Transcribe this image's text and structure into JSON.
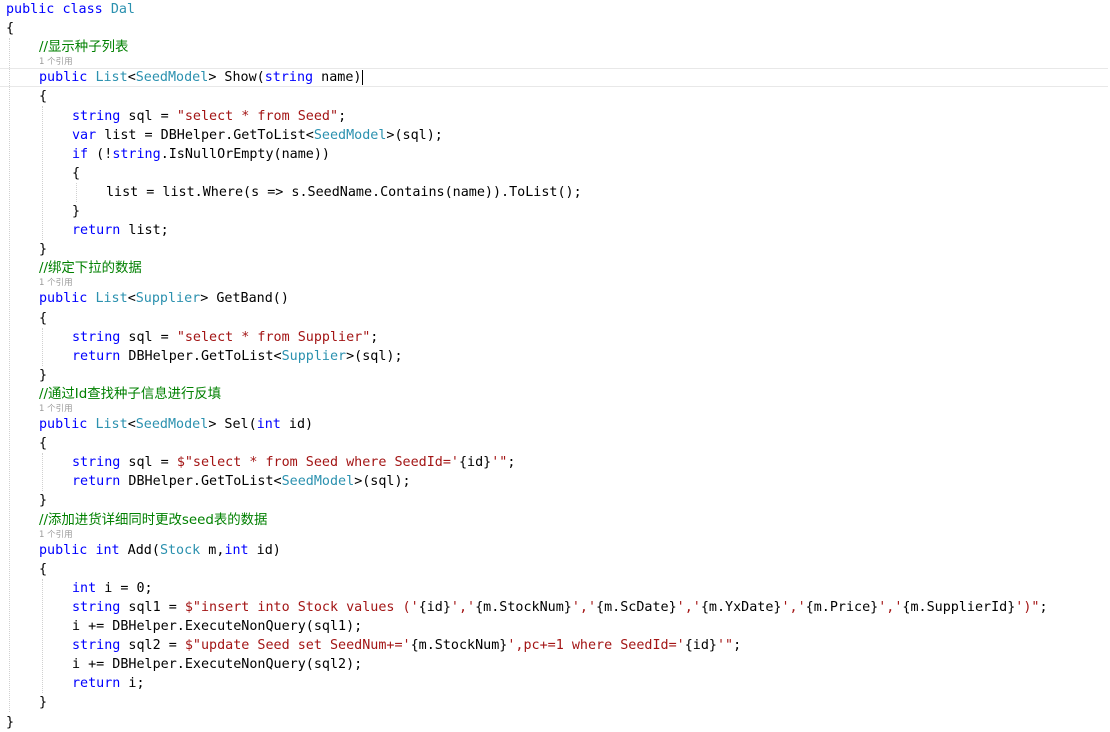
{
  "colors": {
    "keyword": "#0000ff",
    "type": "#2b91af",
    "string": "#a31515",
    "comment": "#008000",
    "plain": "#000000",
    "codelens": "#9a9a9a"
  },
  "lines": [
    {
      "indent": 0,
      "tokens": [
        {
          "t": "public",
          "c": "kw"
        },
        {
          "t": " "
        },
        {
          "t": "class",
          "c": "kw"
        },
        {
          "t": " "
        },
        {
          "t": "Dal",
          "c": "ty"
        }
      ]
    },
    {
      "indent": 0,
      "tokens": [
        {
          "t": "{"
        }
      ]
    },
    {
      "indent": 1,
      "tokens": [
        {
          "t": "//显示种子列表",
          "c": "cm"
        }
      ]
    },
    {
      "indent": 1,
      "lens": "1 个引用"
    },
    {
      "indent": 1,
      "current": true,
      "tokens": [
        {
          "t": "public",
          "c": "kw"
        },
        {
          "t": " "
        },
        {
          "t": "List",
          "c": "ty"
        },
        {
          "t": "<"
        },
        {
          "t": "SeedModel",
          "c": "ty"
        },
        {
          "t": "> Show("
        },
        {
          "t": "string",
          "c": "kw"
        },
        {
          "t": " name)"
        }
      ]
    },
    {
      "indent": 1,
      "tokens": [
        {
          "t": "{"
        }
      ]
    },
    {
      "indent": 2,
      "tokens": [
        {
          "t": "string",
          "c": "kw"
        },
        {
          "t": " sql = "
        },
        {
          "t": "\"select * from Seed\"",
          "c": "st"
        },
        {
          "t": ";"
        }
      ]
    },
    {
      "indent": 2,
      "tokens": [
        {
          "t": "var",
          "c": "kw"
        },
        {
          "t": " list = DBHelper.GetToList<"
        },
        {
          "t": "SeedModel",
          "c": "ty"
        },
        {
          "t": ">(sql);"
        }
      ]
    },
    {
      "indent": 2,
      "tokens": [
        {
          "t": "if",
          "c": "kw"
        },
        {
          "t": " (!"
        },
        {
          "t": "string",
          "c": "kw"
        },
        {
          "t": ".IsNullOrEmpty(name))"
        }
      ]
    },
    {
      "indent": 2,
      "tokens": [
        {
          "t": "{"
        }
      ]
    },
    {
      "indent": 3,
      "tokens": [
        {
          "t": "list = list.Where(s => s.SeedName.Contains(name)).ToList();"
        }
      ]
    },
    {
      "indent": 2,
      "tokens": [
        {
          "t": "}"
        }
      ]
    },
    {
      "indent": 2,
      "tokens": [
        {
          "t": "return",
          "c": "kw"
        },
        {
          "t": " list;"
        }
      ]
    },
    {
      "indent": 1,
      "tokens": [
        {
          "t": "}"
        }
      ]
    },
    {
      "indent": 1,
      "tokens": [
        {
          "t": "//绑定下拉的数据",
          "c": "cm"
        }
      ]
    },
    {
      "indent": 1,
      "lens": "1 个引用"
    },
    {
      "indent": 1,
      "tokens": [
        {
          "t": "public",
          "c": "kw"
        },
        {
          "t": " "
        },
        {
          "t": "List",
          "c": "ty"
        },
        {
          "t": "<"
        },
        {
          "t": "Supplier",
          "c": "ty"
        },
        {
          "t": "> GetBand()"
        }
      ]
    },
    {
      "indent": 1,
      "tokens": [
        {
          "t": "{"
        }
      ]
    },
    {
      "indent": 2,
      "tokens": [
        {
          "t": "string",
          "c": "kw"
        },
        {
          "t": " sql = "
        },
        {
          "t": "\"select * from Supplier\"",
          "c": "st"
        },
        {
          "t": ";"
        }
      ]
    },
    {
      "indent": 2,
      "tokens": [
        {
          "t": "return",
          "c": "kw"
        },
        {
          "t": " DBHelper.GetToList<"
        },
        {
          "t": "Supplier",
          "c": "ty"
        },
        {
          "t": ">(sql);"
        }
      ]
    },
    {
      "indent": 1,
      "tokens": [
        {
          "t": "}"
        }
      ]
    },
    {
      "indent": 1,
      "tokens": [
        {
          "t": "//通过Id查找种子信息进行反填",
          "c": "cm"
        }
      ]
    },
    {
      "indent": 1,
      "lens": "1 个引用"
    },
    {
      "indent": 1,
      "tokens": [
        {
          "t": "public",
          "c": "kw"
        },
        {
          "t": " "
        },
        {
          "t": "List",
          "c": "ty"
        },
        {
          "t": "<"
        },
        {
          "t": "SeedModel",
          "c": "ty"
        },
        {
          "t": "> Sel("
        },
        {
          "t": "int",
          "c": "kw"
        },
        {
          "t": " id)"
        }
      ]
    },
    {
      "indent": 1,
      "tokens": [
        {
          "t": "{"
        }
      ]
    },
    {
      "indent": 2,
      "tokens": [
        {
          "t": "string",
          "c": "kw"
        },
        {
          "t": " sql = "
        },
        {
          "t": "$\"select * from Seed where SeedId='",
          "c": "st"
        },
        {
          "t": "{id}"
        },
        {
          "t": "'\"",
          "c": "st"
        },
        {
          "t": ";"
        }
      ]
    },
    {
      "indent": 2,
      "tokens": [
        {
          "t": "return",
          "c": "kw"
        },
        {
          "t": " DBHelper.GetToList<"
        },
        {
          "t": "SeedModel",
          "c": "ty"
        },
        {
          "t": ">(sql);"
        }
      ]
    },
    {
      "indent": 1,
      "tokens": [
        {
          "t": "}"
        }
      ]
    },
    {
      "indent": 1,
      "tokens": [
        {
          "t": "//添加进货详细同时更改seed表的数据",
          "c": "cm"
        }
      ]
    },
    {
      "indent": 1,
      "lens": "1 个引用"
    },
    {
      "indent": 1,
      "tokens": [
        {
          "t": "public",
          "c": "kw"
        },
        {
          "t": " "
        },
        {
          "t": "int",
          "c": "kw"
        },
        {
          "t": " Add("
        },
        {
          "t": "Stock",
          "c": "ty"
        },
        {
          "t": " m,"
        },
        {
          "t": "int",
          "c": "kw"
        },
        {
          "t": " id)"
        }
      ]
    },
    {
      "indent": 1,
      "tokens": [
        {
          "t": "{"
        }
      ]
    },
    {
      "indent": 2,
      "tokens": [
        {
          "t": "int",
          "c": "kw"
        },
        {
          "t": " i = 0;"
        }
      ]
    },
    {
      "indent": 2,
      "tokens": [
        {
          "t": "string",
          "c": "kw"
        },
        {
          "t": " sql1 = "
        },
        {
          "t": "$\"insert into Stock values ('",
          "c": "st"
        },
        {
          "t": "{id}"
        },
        {
          "t": "','",
          "c": "st"
        },
        {
          "t": "{m.StockNum}"
        },
        {
          "t": "','",
          "c": "st"
        },
        {
          "t": "{m.ScDate}"
        },
        {
          "t": "','",
          "c": "st"
        },
        {
          "t": "{m.YxDate}"
        },
        {
          "t": "','",
          "c": "st"
        },
        {
          "t": "{m.Price}"
        },
        {
          "t": "','",
          "c": "st"
        },
        {
          "t": "{m.SupplierId}"
        },
        {
          "t": "')\"",
          "c": "st"
        },
        {
          "t": ";"
        }
      ]
    },
    {
      "indent": 2,
      "tokens": [
        {
          "t": "i += DBHelper.ExecuteNonQuery(sql1);"
        }
      ]
    },
    {
      "indent": 2,
      "tokens": [
        {
          "t": "string",
          "c": "kw"
        },
        {
          "t": " sql2 = "
        },
        {
          "t": "$\"update Seed set SeedNum+='",
          "c": "st"
        },
        {
          "t": "{m.StockNum}"
        },
        {
          "t": "',pc+=1 where SeedId='",
          "c": "st"
        },
        {
          "t": "{id}"
        },
        {
          "t": "'\"",
          "c": "st"
        },
        {
          "t": ";"
        }
      ]
    },
    {
      "indent": 2,
      "tokens": [
        {
          "t": "i += DBHelper.ExecuteNonQuery(sql2);"
        }
      ]
    },
    {
      "indent": 2,
      "tokens": [
        {
          "t": "return",
          "c": "kw"
        },
        {
          "t": " i;"
        }
      ]
    },
    {
      "indent": 1,
      "tokens": [
        {
          "t": "}"
        }
      ]
    },
    {
      "indent": 0,
      "tokens": [
        {
          "t": "}"
        }
      ]
    }
  ]
}
